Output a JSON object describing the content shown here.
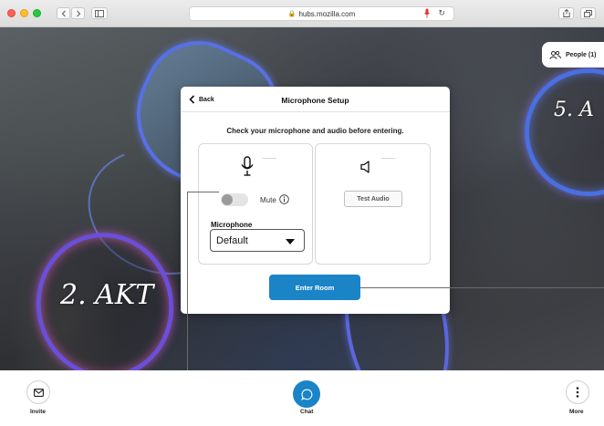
{
  "browser": {
    "url": "hubs.mozilla.com"
  },
  "scene": {
    "sign_left": "2. AKT",
    "sign_right": "5. A"
  },
  "people_button": {
    "label": "People (1)"
  },
  "modal": {
    "back_label": "Back",
    "title": "Microphone Setup",
    "subtitle": "Check your microphone and audio before entering.",
    "mute_label": "Mute",
    "mute_on": false,
    "microphone_label": "Microphone",
    "microphone_value": "Default",
    "test_audio_label": "Test Audio",
    "enter_room_label": "Enter Room"
  },
  "bottom_bar": {
    "invite_label": "Invite",
    "chat_label": "Chat",
    "more_label": "More"
  },
  "colors": {
    "accent": "#1a84c7",
    "mic_indicator": "#e0362c"
  }
}
